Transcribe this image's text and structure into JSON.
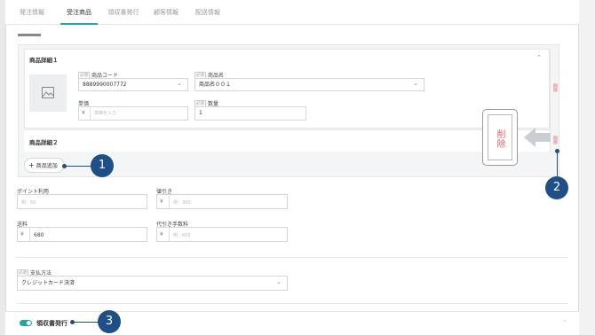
{
  "tabs": [
    {
      "label": "発注情報"
    },
    {
      "label": "受注商品"
    },
    {
      "label": "領収書発行"
    },
    {
      "label": "顧客情報"
    },
    {
      "label": "配送情報"
    }
  ],
  "product_detail_1": {
    "title": "商品詳細１",
    "code_label": "商品コード",
    "code_required": "必須",
    "code_value": "8889990007772",
    "name_label": "商品名",
    "name_required": "必須",
    "name_value": "商品名００１",
    "price_label": "単価",
    "price_yen": "¥",
    "price_placeholder": "単価を入力",
    "qty_label": "数量",
    "qty_required": "必須",
    "qty_value": "1",
    "delete_label": "削除"
  },
  "product_detail_2": {
    "title": "商品詳細２",
    "delete_label": "削除"
  },
  "add_button_label": "商品追加",
  "points": {
    "label": "ポイント利用",
    "placeholder": "例：50"
  },
  "discount": {
    "label": "値引き",
    "yen": "¥",
    "placeholder": "例：300"
  },
  "shipping": {
    "label": "送料",
    "yen": "¥",
    "value": "680"
  },
  "cod_fee": {
    "label": "代引き手数料",
    "yen": "¥",
    "placeholder": "例：600"
  },
  "payment": {
    "label": "支払方法",
    "required": "必須",
    "value": "クレジットカード決済"
  },
  "zoom_callout": {
    "text": "削除"
  },
  "footer": {
    "label": "領収書発行"
  },
  "callouts": {
    "one": "1",
    "two": "2",
    "three": "3"
  },
  "colors": {
    "accent": "#1fa7a8",
    "callout": "#1e4f86",
    "delete": "#e3626b"
  }
}
